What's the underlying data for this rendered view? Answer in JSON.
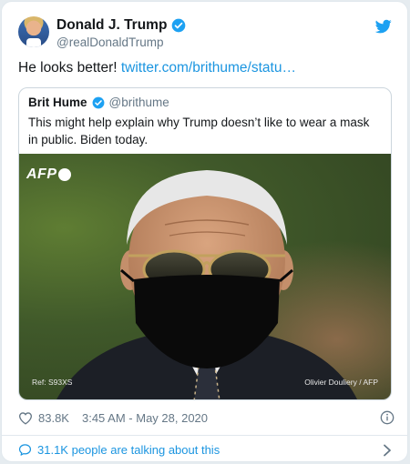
{
  "author": {
    "display_name": "Donald J. Trump",
    "handle": "@realDonaldTrump"
  },
  "tweet": {
    "text": "He looks better! ",
    "link_text": "twitter.com/brithume/statu…"
  },
  "quoted_tweet": {
    "display_name": "Brit Hume",
    "handle": "@brithume",
    "text": "This might help explain why Trump doesn’t like to wear a mask in public. Biden today.",
    "photo": {
      "logo": "AFP",
      "ref": "Ref: S93XS",
      "credit": "Olivier Douliery / AFP"
    }
  },
  "meta": {
    "likes": "83.8K",
    "timestamp": "3:45 AM - May 28, 2020"
  },
  "conversation": {
    "label": "31.1K people are talking about this"
  },
  "colors": {
    "accent": "#1b95e0",
    "verified": "#1da1f2",
    "secondary_text": "#657786"
  },
  "icons": [
    "verified-badge-icon",
    "twitter-bird-icon",
    "heart-icon",
    "info-icon",
    "speech-bubble-icon",
    "chevron-right-icon"
  ]
}
